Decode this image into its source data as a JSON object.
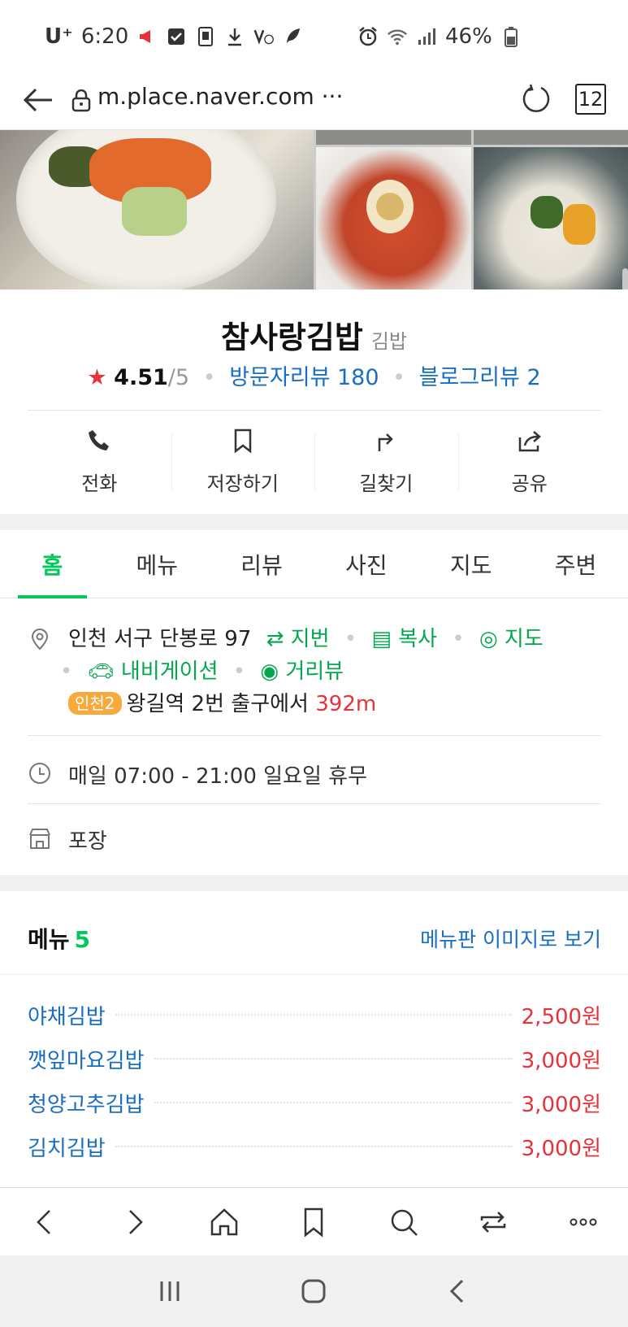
{
  "status_bar": {
    "carrier": "U⁺",
    "time": "6:20",
    "battery": "46%",
    "notification_icons": [
      "megaphone-icon",
      "check-box-icon",
      "phone-icon",
      "download-icon",
      "volte-icon",
      "feather-icon"
    ],
    "system_icons": [
      "alarm-icon",
      "wifi-icon",
      "signal-icon",
      "battery-icon"
    ]
  },
  "browser": {
    "url": "m.place.naver.com ···",
    "tab_count": "12"
  },
  "place": {
    "name": "참사랑김밥",
    "category": "김밥",
    "rating": "4.51",
    "rating_max": "/5",
    "visitor_reviews": "방문자리뷰 180",
    "blog_reviews": "블로그리뷰 2"
  },
  "actions": [
    {
      "label": "전화",
      "icon": "phone-icon"
    },
    {
      "label": "저장하기",
      "icon": "bookmark-icon"
    },
    {
      "label": "길찾기",
      "icon": "directions-icon"
    },
    {
      "label": "공유",
      "icon": "share-icon"
    }
  ],
  "tabs": [
    {
      "label": "홈",
      "active": true
    },
    {
      "label": "메뉴"
    },
    {
      "label": "리뷰"
    },
    {
      "label": "사진"
    },
    {
      "label": "지도"
    },
    {
      "label": "주변"
    }
  ],
  "info": {
    "address": "인천 서구 단봉로 97",
    "jibun_link": "지번",
    "copy_link": "복사",
    "map_link": "지도",
    "navi_link": "내비게이션",
    "street_link": "거리뷰",
    "subway_badge": "인천2",
    "station_text": "왕길역 2번 출구에서",
    "distance": "392m",
    "hours": "매일 07:00 - 21:00 일요일 휴무",
    "service": "포장"
  },
  "menu": {
    "title": "메뉴",
    "count": "5",
    "image_link": "메뉴판 이미지로 보기",
    "items": [
      {
        "name": "야채김밥",
        "price": "2,500원"
      },
      {
        "name": "깻잎마요김밥",
        "price": "3,000원"
      },
      {
        "name": "청양고추김밥",
        "price": "3,000원"
      },
      {
        "name": "김치김밥",
        "price": "3,000원"
      }
    ]
  },
  "colors": {
    "naver_green": "#03c75a",
    "link_blue": "#1a6ec2",
    "price_red": "#e8323a",
    "badge_orange": "#f7a93c"
  }
}
